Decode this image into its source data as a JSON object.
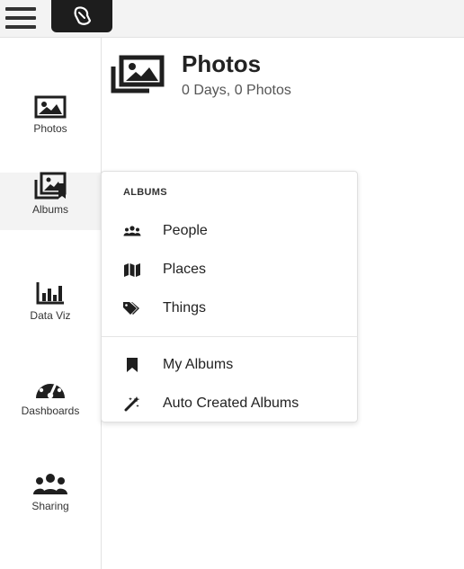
{
  "sidebar": {
    "items": [
      {
        "label": "Photos",
        "icon": "photo-icon"
      },
      {
        "label": "Albums",
        "icon": "albums-icon"
      },
      {
        "label": "Data Viz",
        "icon": "bar-chart-icon"
      },
      {
        "label": "Dashboards",
        "icon": "gauge-icon"
      },
      {
        "label": "Sharing",
        "icon": "users-icon"
      }
    ],
    "active": "Albums"
  },
  "header": {
    "title": "Photos",
    "subtitle": "0 Days, 0 Photos"
  },
  "albums_menu": {
    "heading": "ALBUMS",
    "items": [
      {
        "label": "People",
        "icon": "people-icon"
      },
      {
        "label": "Places",
        "icon": "map-icon"
      },
      {
        "label": "Things",
        "icon": "tags-icon"
      },
      {
        "label": "My Albums",
        "icon": "bookmark-icon"
      },
      {
        "label": "Auto Created Albums",
        "icon": "magic-wand-icon"
      }
    ]
  },
  "colors": {
    "topbar_bg": "#f3f3f3",
    "logo_bg": "#1d1d1d",
    "icon_color": "#1f1f1f",
    "active_bg": "#f3f3f3"
  }
}
